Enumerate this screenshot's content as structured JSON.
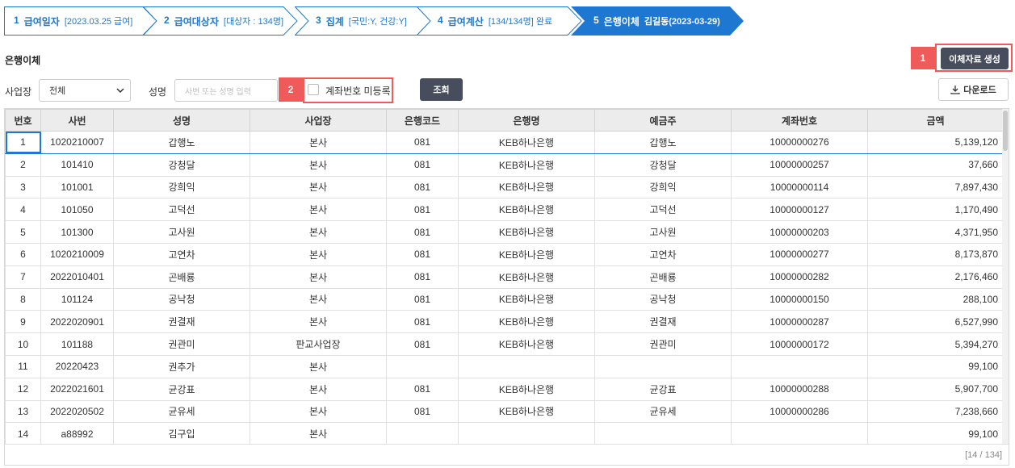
{
  "steps": [
    {
      "no": "1",
      "label": "급여일자",
      "sub": "[2023.03.25 급여]"
    },
    {
      "no": "2",
      "label": "급여대상자",
      "sub": "[대상자 : 134명]"
    },
    {
      "no": "3",
      "label": "집계",
      "sub": "[국민:Y, 건강:Y]"
    },
    {
      "no": "4",
      "label": "급여계산",
      "sub": "[134/134명] 완료"
    },
    {
      "no": "5",
      "label": "은행이체",
      "sub": "김길동(2023-03-29)"
    }
  ],
  "section_title": "은행이체",
  "create_button": "이체자료 생성",
  "badge1": "1",
  "badge2": "2",
  "filters": {
    "site_label": "사업장",
    "site_value": "전체",
    "name_label": "성명",
    "name_placeholder": "사번 또는 성명 입력",
    "unregistered_label": "계좌번호 미등록",
    "search_button": "조회",
    "download_button": "다운로드"
  },
  "table": {
    "columns": [
      "번호",
      "사번",
      "성명",
      "사업장",
      "은행코드",
      "은행명",
      "예금주",
      "계좌번호",
      "금액"
    ],
    "rows": [
      [
        "1",
        "1020210007",
        "갑행노",
        "본사",
        "081",
        "KEB하나은행",
        "갑행노",
        "10000000276",
        "5,139,120"
      ],
      [
        "2",
        "101410",
        "강청달",
        "본사",
        "081",
        "KEB하나은행",
        "강청달",
        "10000000257",
        "37,660"
      ],
      [
        "3",
        "101001",
        "강희익",
        "본사",
        "081",
        "KEB하나은행",
        "강희익",
        "10000000114",
        "7,897,430"
      ],
      [
        "4",
        "101050",
        "고덕선",
        "본사",
        "081",
        "KEB하나은행",
        "고덕선",
        "10000000127",
        "1,170,490"
      ],
      [
        "5",
        "101300",
        "고사원",
        "본사",
        "081",
        "KEB하나은행",
        "고사원",
        "10000000203",
        "4,371,950"
      ],
      [
        "6",
        "1020210009",
        "고연차",
        "본사",
        "081",
        "KEB하나은행",
        "고연차",
        "10000000277",
        "8,173,870"
      ],
      [
        "7",
        "2022010401",
        "곤배룡",
        "본사",
        "081",
        "KEB하나은행",
        "곤배룡",
        "10000000282",
        "2,176,460"
      ],
      [
        "8",
        "101124",
        "공낙청",
        "본사",
        "081",
        "KEB하나은행",
        "공낙청",
        "10000000150",
        "288,100"
      ],
      [
        "9",
        "2022020901",
        "권결재",
        "본사",
        "081",
        "KEB하나은행",
        "권결재",
        "10000000287",
        "6,527,990"
      ],
      [
        "10",
        "101188",
        "권관미",
        "판교사업장",
        "081",
        "KEB하나은행",
        "권관미",
        "10000000172",
        "5,394,270"
      ],
      [
        "11",
        "20220423",
        "권추가",
        "본사",
        "",
        "",
        "",
        "",
        "99,100"
      ],
      [
        "12",
        "2022021601",
        "균강표",
        "본사",
        "081",
        "KEB하나은행",
        "균강표",
        "10000000288",
        "5,907,700"
      ],
      [
        "13",
        "2022020502",
        "균유세",
        "본사",
        "081",
        "KEB하나은행",
        "균유세",
        "10000000286",
        "7,238,660"
      ],
      [
        "14",
        "a88992",
        "김구입",
        "본사",
        "",
        "",
        "",
        "",
        "99,100"
      ]
    ]
  },
  "footer": "[14 / 134]",
  "colors": {
    "accent": "#1e78d2",
    "badge": "#ef5b5b",
    "dark_button": "#474d5c"
  }
}
